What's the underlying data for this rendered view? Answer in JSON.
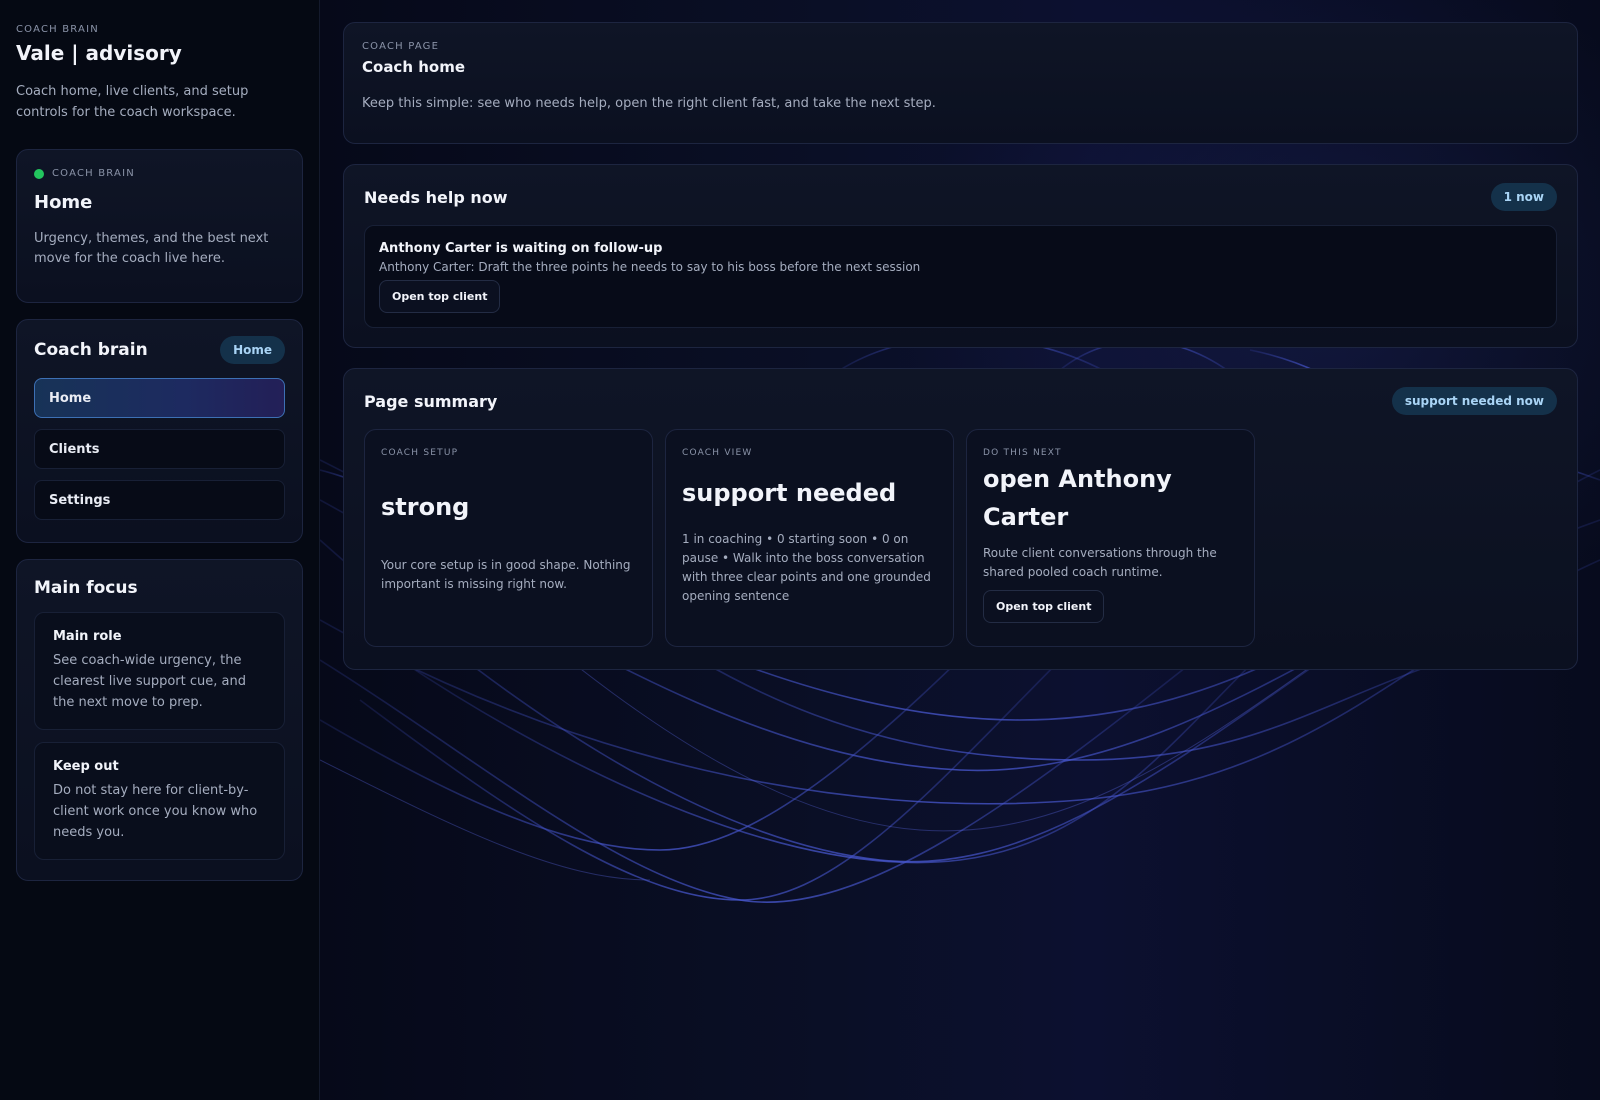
{
  "sidebar": {
    "eyebrow": "COACH BRAIN",
    "title": "Vale | advisory",
    "description": "Coach home, live clients, and setup controls for the coach workspace.",
    "status_card": {
      "eyebrow": "COACH BRAIN",
      "status_color": "#22c55e",
      "title": "Home",
      "description": "Urgency, themes, and the best next move for the coach live here."
    },
    "nav": {
      "title": "Coach brain",
      "badge": "Home",
      "items": [
        {
          "label": "Home",
          "active": true
        },
        {
          "label": "Clients",
          "active": false
        },
        {
          "label": "Settings",
          "active": false
        }
      ]
    },
    "focus": {
      "title": "Main focus",
      "items": [
        {
          "title": "Main role",
          "text": "See coach-wide urgency, the clearest live support cue, and the next move to prep."
        },
        {
          "title": "Keep out",
          "text": "Do not stay here for client-by-client work once you know who needs you."
        }
      ]
    }
  },
  "header": {
    "eyebrow": "COACH PAGE",
    "title": "Coach home",
    "description": "Keep this simple: see who needs help, open the right client fast, and take the next step."
  },
  "needs_help": {
    "title": "Needs help now",
    "badge": "1 now",
    "alert": {
      "title": "Anthony Carter is waiting on follow-up",
      "description": "Anthony Carter: Draft the three points he needs to say to his boss before the next session",
      "button": "Open top client"
    }
  },
  "summary": {
    "title": "Page summary",
    "badge": "support needed now",
    "cards": [
      {
        "eyebrow": "COACH SETUP",
        "value": "strong",
        "text": "Your core setup is in good shape. Nothing important is missing right now."
      },
      {
        "eyebrow": "COACH VIEW",
        "value": "support needed",
        "text": "1 in coaching • 0 starting soon • 0 on pause • Walk into the boss conversation with three clear points and one grounded opening sentence"
      },
      {
        "eyebrow": "DO THIS NEXT",
        "value": "open Anthony Carter",
        "text": "Route client conversations through the shared pooled coach runtime.",
        "button": "Open top client"
      }
    ]
  },
  "colors": {
    "accent": "#3d70b4",
    "badge_bg": "#14314a",
    "badge_text": "#a9d4f5",
    "status_green": "#22c55e"
  }
}
